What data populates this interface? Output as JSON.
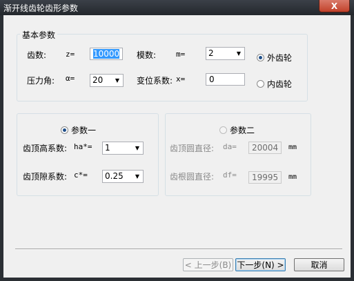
{
  "window": {
    "title": "渐开线齿轮齿形参数",
    "close_label": "X"
  },
  "basic": {
    "legend": "基本参数",
    "teeth_label": "齿数:",
    "teeth_sym": "z=",
    "teeth_value": "10000",
    "module_label": "模数:",
    "module_sym": "m=",
    "module_value": "2",
    "pressure_label": "压力角:",
    "pressure_sym": "α=",
    "pressure_value": "20",
    "shift_label": "变位系数:",
    "shift_sym": "x=",
    "shift_value": "0",
    "external_label": "外齿轮",
    "internal_label": "内齿轮"
  },
  "param1": {
    "radio_label": "参数一",
    "addendum_label": "齿顶高系数:",
    "addendum_sym": "ha*=",
    "addendum_value": "1",
    "clearance_label": "齿顶隙系数:",
    "clearance_sym": "c*=",
    "clearance_value": "0.25"
  },
  "param2": {
    "radio_label": "参数二",
    "tip_label": "齿顶圆直径:",
    "tip_sym": "da=",
    "tip_value": "20004",
    "tip_unit": "mm",
    "root_label": "齿根圆直径:",
    "root_sym": "df=",
    "root_value": "19995",
    "root_unit": "mm"
  },
  "buttons": {
    "prev_label": "< 上一步(B)",
    "next_label": "下一步(N) >",
    "cancel_label": "取消"
  }
}
